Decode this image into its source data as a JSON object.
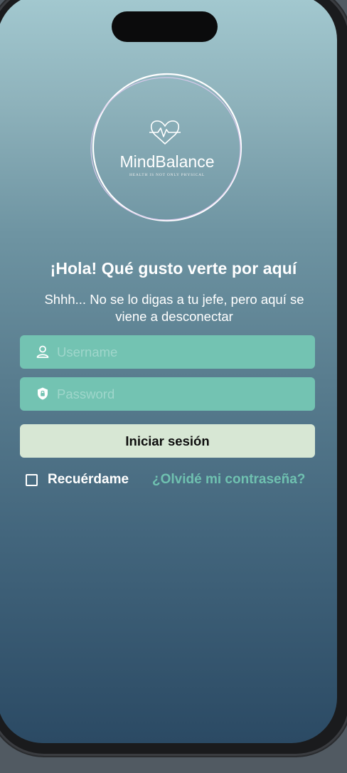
{
  "app": {
    "logo_name": "MindBalance",
    "logo_tagline": "HEALTH IS NOT ONLY PHYSICAL"
  },
  "greeting": {
    "title": "¡Hola! Qué gusto verte por aquí",
    "subtitle": "Shhh... No se lo digas a tu jefe, pero aquí se viene a desconectar"
  },
  "form": {
    "username": {
      "placeholder": "Username",
      "value": "",
      "icon": "user-icon"
    },
    "password": {
      "placeholder": "Password",
      "value": "",
      "icon": "shield-lock-icon"
    },
    "submit_label": "Iniciar sesión",
    "remember_label": "Recuérdame",
    "remember_checked": false,
    "forgot_label": "¿Olvidé mi contraseña?"
  },
  "colors": {
    "field_bg": "#73c3b2",
    "button_bg": "#d7e7d4",
    "link": "#6fc1b0",
    "gradient_top": "#a3c9d0",
    "gradient_bottom": "#2b4a64"
  }
}
